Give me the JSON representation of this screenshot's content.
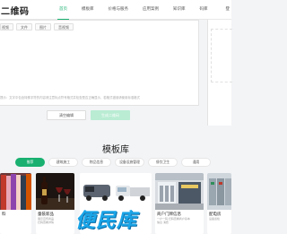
{
  "header": {
    "logo": "二维码",
    "nav": [
      "首页",
      "模板库",
      "价格与服务",
      "应用案例",
      "知识库",
      "码库"
    ],
    "active_nav": 0,
    "login": "登"
  },
  "editor": {
    "toolbar": [
      "视频",
      "文件",
      "图片",
      "音视频"
    ],
    "hint": "提示：文字中包含特殊字符的内容请注意标点符号格式并检查是否正确显示，若格式错误请使用标准格式"
  },
  "buttons": {
    "clear": "清空编辑",
    "generate": "生成二维码"
  },
  "templates": {
    "title": "模板库",
    "categories": [
      "推荐",
      "建筑施工",
      "物品信息",
      "设备设施管理",
      "餐饮卫生",
      "通用"
    ],
    "active_category": 0,
    "cards": [
      {
        "title": "料",
        "desc": ""
      },
      {
        "title": "童裝新品",
        "desc": "展示宣传商品\n扫码查看详情"
      },
      {
        "title": "",
        "desc": ""
      },
      {
        "title": "商户门牌信息",
        "desc": "一户一码 扫码查看商户基本\n信息 消费"
      },
      {
        "title": "配电房",
        "desc": "设备巡检"
      }
    ]
  },
  "watermark": "便民库",
  "colors": {
    "accent": "#19b070",
    "generate_disabled": "#b9ecd3",
    "watermark": "#1aa5e8"
  }
}
